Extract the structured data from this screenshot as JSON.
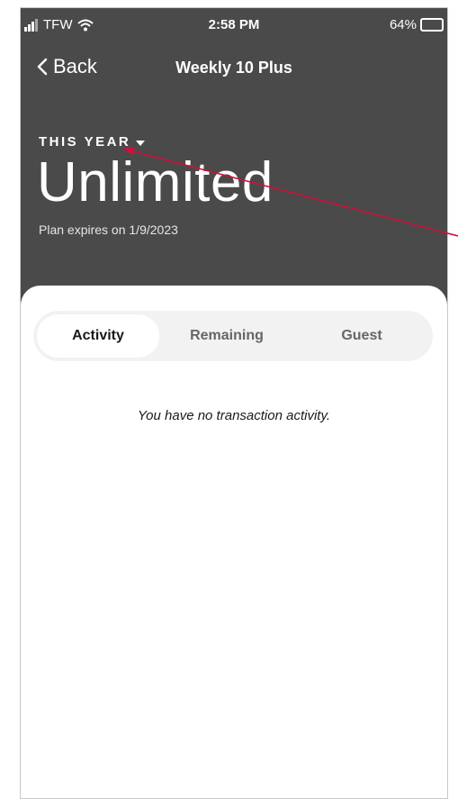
{
  "status_bar": {
    "carrier": "TFW",
    "time": "2:58 PM",
    "battery": "64%"
  },
  "nav": {
    "back_label": "Back",
    "title": "Weekly 10 Plus"
  },
  "plan": {
    "period_label": "THIS YEAR",
    "value": "Unlimited",
    "expiry": "Plan expires on 1/9/2023"
  },
  "tabs": [
    {
      "label": "Activity",
      "active": true
    },
    {
      "label": "Remaining",
      "active": false
    },
    {
      "label": "Guest",
      "active": false
    }
  ],
  "activity": {
    "empty_message": "You have no transaction activity."
  },
  "colors": {
    "header_bg": "#4a4a4a",
    "annotation_arrow": "#d0103a",
    "tab_track": "#f2f2f2"
  },
  "icons": [
    "signal-icon",
    "wifi-icon",
    "battery-icon",
    "chevron-left-icon",
    "caret-down-icon"
  ]
}
